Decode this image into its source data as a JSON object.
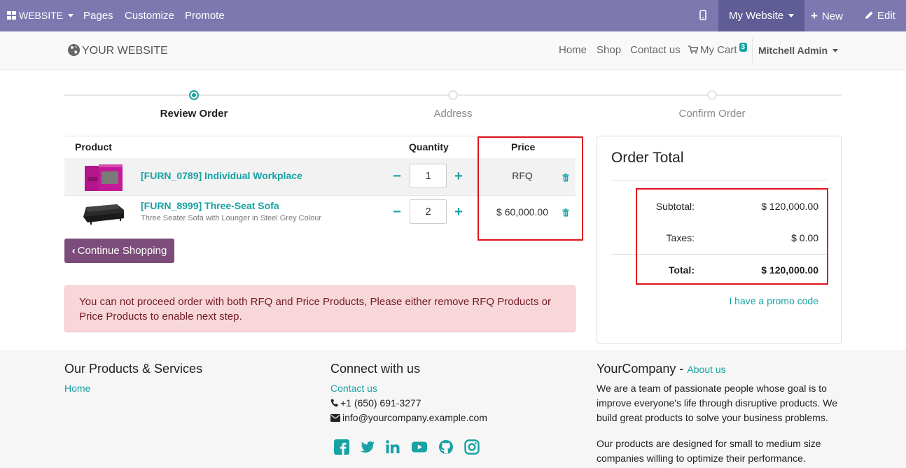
{
  "admin_bar": {
    "website_label": "WEBSITE",
    "menu": [
      "Pages",
      "Customize",
      "Promote"
    ],
    "my_website": "My Website",
    "new_label": "New",
    "edit_label": "Edit"
  },
  "header": {
    "logo_text": "YOUR WEBSITE",
    "nav": [
      "Home",
      "Shop",
      "Contact us"
    ],
    "cart_label": "My Cart",
    "cart_count": "3",
    "user_name": "Mitchell Admin"
  },
  "wizard": {
    "steps": [
      "Review Order",
      "Address",
      "Confirm Order"
    ],
    "active_index": 0
  },
  "cart": {
    "columns": {
      "product": "Product",
      "quantity": "Quantity",
      "price": "Price"
    },
    "items": [
      {
        "name": "[FURN_0789] Individual Workplace",
        "description": "",
        "quantity": "1",
        "price": "RFQ"
      },
      {
        "name": "[FURN_8999] Three-Seat Sofa",
        "description": "Three Seater Sofa with Lounger in Steel Grey Colour",
        "quantity": "2",
        "price": "$ 60,000.00"
      }
    ],
    "continue_label": "Continue Shopping",
    "alert": "You can not proceed order with both RFQ and Price Products, Please either remove RFQ Products or Price Products to enable next step."
  },
  "order_total": {
    "title": "Order Total",
    "subtotal_label": "Subtotal:",
    "subtotal_value": "$ 120,000.00",
    "taxes_label": "Taxes:",
    "taxes_value": "$ 0.00",
    "total_label": "Total:",
    "total_value": "$ 120,000.00",
    "promo_label": "I have a promo code"
  },
  "footer": {
    "col1_title": "Our Products & Services",
    "col1_link": "Home",
    "col2_title": "Connect with us",
    "contact_link": "Contact us",
    "phone": "+1 (650) 691-3277",
    "email": "info@yourcompany.example.com",
    "social_icons": [
      "facebook-icon",
      "twitter-icon",
      "linkedin-icon",
      "youtube-icon",
      "github-icon",
      "instagram-icon"
    ],
    "col3_title": "YourCompany",
    "col3_separator": " - ",
    "about_link": "About us",
    "about_text_1": "We are a team of passionate people whose goal is to improve everyone's life through disruptive products. We build great products to solve your business problems.",
    "about_text_2": "Our products are designed for small to medium size companies willing to optimize their performance."
  },
  "colors": {
    "admin_bar": "#7d79b0",
    "accent": "#17a2a4",
    "primary_button": "#7c4d7a",
    "alert_bg": "#f8d7da",
    "highlight_border": "#e0141e"
  }
}
